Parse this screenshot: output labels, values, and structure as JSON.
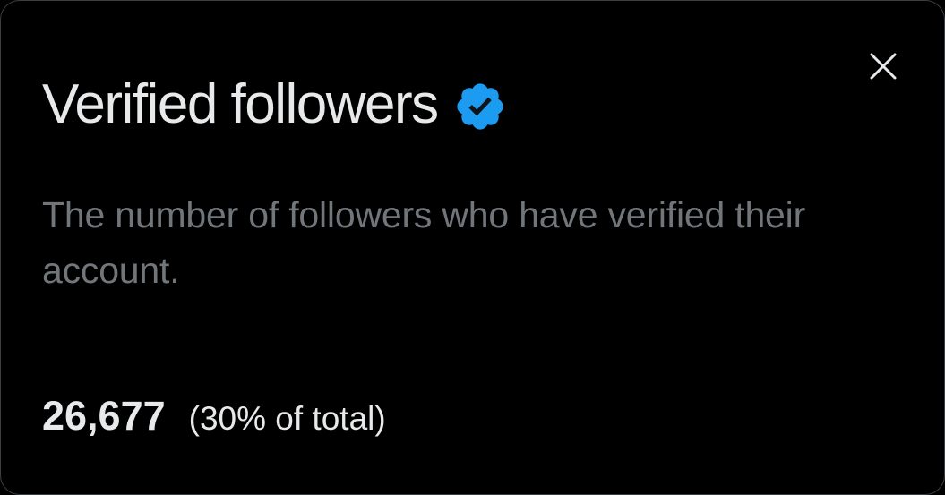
{
  "dialog": {
    "title": "Verified followers",
    "description": "The number of followers who have verified their account.",
    "count": "26,677",
    "percent_text": "(30% of total)",
    "close_icon": "close-x",
    "badge_icon": "verified-check-badge"
  },
  "colors": {
    "background": "#000000",
    "title_text": "#e7e9ea",
    "secondary_text": "#71767b",
    "verified_badge": "#1d9bf0",
    "border": "#3a3f44"
  }
}
